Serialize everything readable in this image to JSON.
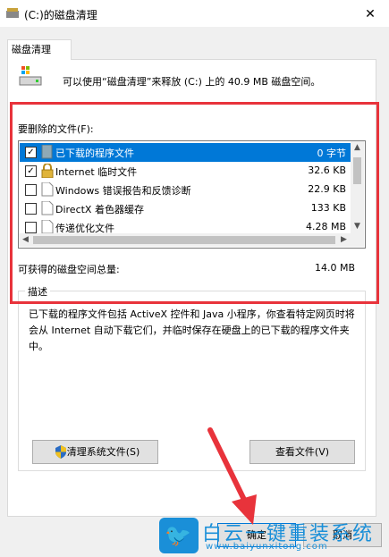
{
  "window": {
    "title": "(C:)的磁盘清理",
    "close_glyph": "✕"
  },
  "tab": {
    "label": "磁盘清理"
  },
  "summary": "可以使用“磁盘清理”来释放 (C:) 上的 40.9 MB 磁盘空间。",
  "files_to_delete_label": "要删除的文件(F):",
  "files": [
    {
      "name": "已下载的程序文件",
      "size": "0 字节",
      "checked": true,
      "selected": true,
      "icon": "file-icon"
    },
    {
      "name": "Internet 临时文件",
      "size": "32.6 KB",
      "checked": true,
      "selected": false,
      "icon": "lock-icon"
    },
    {
      "name": "Windows 错误报告和反馈诊断",
      "size": "22.9 KB",
      "checked": false,
      "selected": false,
      "icon": "file-icon"
    },
    {
      "name": "DirectX 着色器缓存",
      "size": "133 KB",
      "checked": false,
      "selected": false,
      "icon": "file-icon"
    },
    {
      "name": "传递优化文件",
      "size": "4.28 MB",
      "checked": false,
      "selected": false,
      "icon": "file-icon"
    }
  ],
  "total": {
    "label": "可获得的磁盘空间总量:",
    "value": "14.0 MB"
  },
  "description": {
    "label": "描述",
    "text": "已下载的程序文件包括 ActiveX 控件和 Java 小程序，你查看特定网页时将会从 Internet 自动下载它们，并临时保存在硬盘上的已下载的程序文件夹中。"
  },
  "buttons": {
    "clean_system": "清理系统文件(S)",
    "view_files": "查看文件(V)",
    "ok": "确定",
    "cancel": "取消"
  },
  "watermark": {
    "title": "白云一键重装系统",
    "url": "www.baiyunxitong.com"
  },
  "colors": {
    "selection": "#0078d7",
    "highlight_frame": "#e8333b",
    "watermark": "#1a8fd8"
  }
}
